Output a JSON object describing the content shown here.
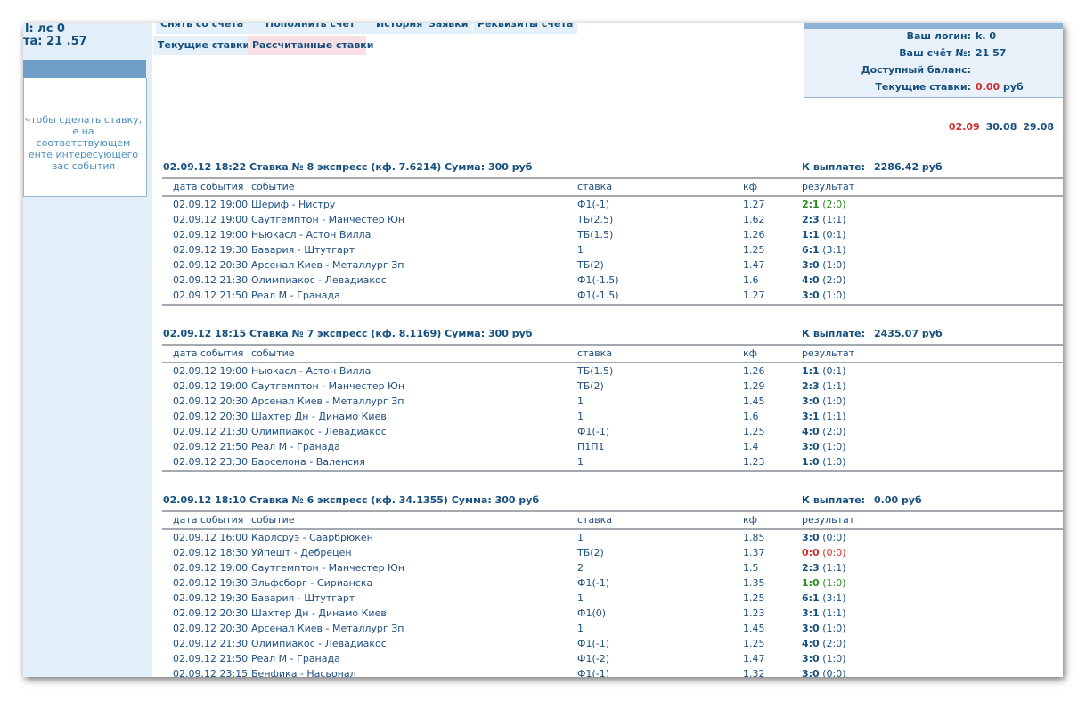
{
  "sidebar": {
    "login_line": "l: лс    0",
    "account_line": "та: 21    .57",
    "hint": "чтобы сделать ставку, е на соответствующем енте интересующего вас события"
  },
  "tabs": {
    "withdraw": "Снять со счета",
    "deposit": "Пополнить счет",
    "history": "История",
    "requests": "Заявки",
    "requisites": "Реквизиты счета",
    "current": "Текущие ставки",
    "calculated": "Рассчитанные ставки"
  },
  "info": {
    "login_label": "Ваш логин:",
    "login_value": "k.    0",
    "account_label": "Ваш счёт №:",
    "account_value": "21    57",
    "balance_label": "Доступный баланс:",
    "balance_value": "",
    "bets_label": "Текущие ставки:",
    "bets_value": "0.00",
    "bets_currency": "руб"
  },
  "dates": [
    "02.09",
    "30.08",
    "29.08"
  ],
  "colors": {
    "accent": "#16507f",
    "red": "#d32b2b",
    "green": "#2e8a1e",
    "panel": "#e8f1fa"
  },
  "columns": {
    "date": "дата события",
    "event": "событие",
    "bet": "ставка",
    "coef": "кф",
    "result": "результат"
  },
  "bets": [
    {
      "title": "02.09.12 18:22  Ставка № 8  экспресс  (кф. 7.6214)   Сумма: 300 руб",
      "payout_label": "К выплате:",
      "payout_value": "2286.42 руб",
      "rows": [
        {
          "date": "02.09.12 19:00",
          "event": "Шериф - Нистру",
          "bet": "Ф1(-1)",
          "coef": "1.27",
          "score": "2:1",
          "half": "(2:0)",
          "status": "win"
        },
        {
          "date": "02.09.12 19:00",
          "event": "Саутгемптон - Манчестер Юн",
          "bet": "ТБ(2.5)",
          "coef": "1.62",
          "score": "2:3",
          "half": "(1:1)",
          "status": ""
        },
        {
          "date": "02.09.12 19:00",
          "event": "Ньюкасл - Астон Вилла",
          "bet": "ТБ(1.5)",
          "coef": "1.26",
          "score": "1:1",
          "half": "(0:1)",
          "status": ""
        },
        {
          "date": "02.09.12 19:30",
          "event": "Бавария - Штутгарт",
          "bet": "1",
          "coef": "1.25",
          "score": "6:1",
          "half": "(3:1)",
          "status": ""
        },
        {
          "date": "02.09.12 20:30",
          "event": "Арсенал Киев - Металлург Зп",
          "bet": "ТБ(2)",
          "coef": "1.47",
          "score": "3:0",
          "half": "(1:0)",
          "status": ""
        },
        {
          "date": "02.09.12 21:30",
          "event": "Олимпиакос - Левадиакос",
          "bet": "Ф1(-1.5)",
          "coef": "1.6",
          "score": "4:0",
          "half": "(2:0)",
          "status": ""
        },
        {
          "date": "02.09.12 21:50",
          "event": "Реал М - Гранада",
          "bet": "Ф1(-1.5)",
          "coef": "1.27",
          "score": "3:0",
          "half": "(1:0)",
          "status": ""
        }
      ]
    },
    {
      "title": "02.09.12 18:15  Ставка № 7  экспресс  (кф. 8.1169)   Сумма: 300 руб",
      "payout_label": "К выплате:",
      "payout_value": "2435.07 руб",
      "rows": [
        {
          "date": "02.09.12 19:00",
          "event": "Ньюкасл - Астон Вилла",
          "bet": "ТБ(1.5)",
          "coef": "1.26",
          "score": "1:1",
          "half": "(0:1)",
          "status": ""
        },
        {
          "date": "02.09.12 19:00",
          "event": "Саутгемптон - Манчестер Юн",
          "bet": "ТБ(2)",
          "coef": "1.29",
          "score": "2:3",
          "half": "(1:1)",
          "status": ""
        },
        {
          "date": "02.09.12 20:30",
          "event": "Арсенал Киев - Металлург Зп",
          "bet": "1",
          "coef": "1.45",
          "score": "3:0",
          "half": "(1:0)",
          "status": ""
        },
        {
          "date": "02.09.12 20:30",
          "event": "Шахтер Дн - Динамо Киев",
          "bet": "1",
          "coef": "1.6",
          "score": "3:1",
          "half": "(1:1)",
          "status": ""
        },
        {
          "date": "02.09.12 21:30",
          "event": "Олимпиакос - Левадиакос",
          "bet": "Ф1(-1)",
          "coef": "1.25",
          "score": "4:0",
          "half": "(2:0)",
          "status": ""
        },
        {
          "date": "02.09.12 21:50",
          "event": "Реал М - Гранада",
          "bet": "П1П1",
          "coef": "1.4",
          "score": "3:0",
          "half": "(1:0)",
          "status": ""
        },
        {
          "date": "02.09.12 23:30",
          "event": "Барселона - Валенсия",
          "bet": "1",
          "coef": "1.23",
          "score": "1:0",
          "half": "(1:0)",
          "status": ""
        }
      ]
    },
    {
      "title": "02.09.12 18:10  Ставка № 6  экспресс  (кф. 34.1355)   Сумма: 300 руб",
      "payout_label": "К выплате:",
      "payout_value": "0.00 руб",
      "rows": [
        {
          "date": "02.09.12 16:00",
          "event": "Карлсруэ - Саарбрюкен",
          "bet": "1",
          "coef": "1.85",
          "score": "3:0",
          "half": "(0:0)",
          "status": ""
        },
        {
          "date": "02.09.12 18:30",
          "event": "Уйпешт - Дебрецен",
          "bet": "ТБ(2)",
          "coef": "1.37",
          "score": "0:0",
          "half": "(0:0)",
          "status": "lose"
        },
        {
          "date": "02.09.12 19:00",
          "event": "Саутгемптон - Манчестер Юн",
          "bet": "2",
          "coef": "1.5",
          "score": "2:3",
          "half": "(1:1)",
          "status": ""
        },
        {
          "date": "02.09.12 19:30",
          "event": "Эльфсборг - Сирианска",
          "bet": "Ф1(-1)",
          "coef": "1.35",
          "score": "1:0",
          "half": "(1:0)",
          "status": "win"
        },
        {
          "date": "02.09.12 19:30",
          "event": "Бавария - Штутгарт",
          "bet": "1",
          "coef": "1.25",
          "score": "6:1",
          "half": "(3:1)",
          "status": ""
        },
        {
          "date": "02.09.12 20:30",
          "event": "Шахтер Дн - Динамо Киев",
          "bet": "Ф1(0)",
          "coef": "1.23",
          "score": "3:1",
          "half": "(1:1)",
          "status": ""
        },
        {
          "date": "02.09.12 20:30",
          "event": "Арсенал Киев - Металлург Зп",
          "bet": "1",
          "coef": "1.45",
          "score": "3:0",
          "half": "(1:0)",
          "status": ""
        },
        {
          "date": "02.09.12 21:30",
          "event": "Олимпиакос - Левадиакос",
          "bet": "Ф1(-1)",
          "coef": "1.25",
          "score": "4:0",
          "half": "(2:0)",
          "status": ""
        },
        {
          "date": "02.09.12 21:50",
          "event": "Реал М - Гранада",
          "bet": "Ф1(-2)",
          "coef": "1.47",
          "score": "3:0",
          "half": "(1:0)",
          "status": ""
        },
        {
          "date": "02.09.12 23:15",
          "event": "Бенфика - Насьонал",
          "bet": "Ф1(-1)",
          "coef": "1.32",
          "score": "3:0",
          "half": "(0:0)",
          "status": ""
        }
      ]
    }
  ]
}
